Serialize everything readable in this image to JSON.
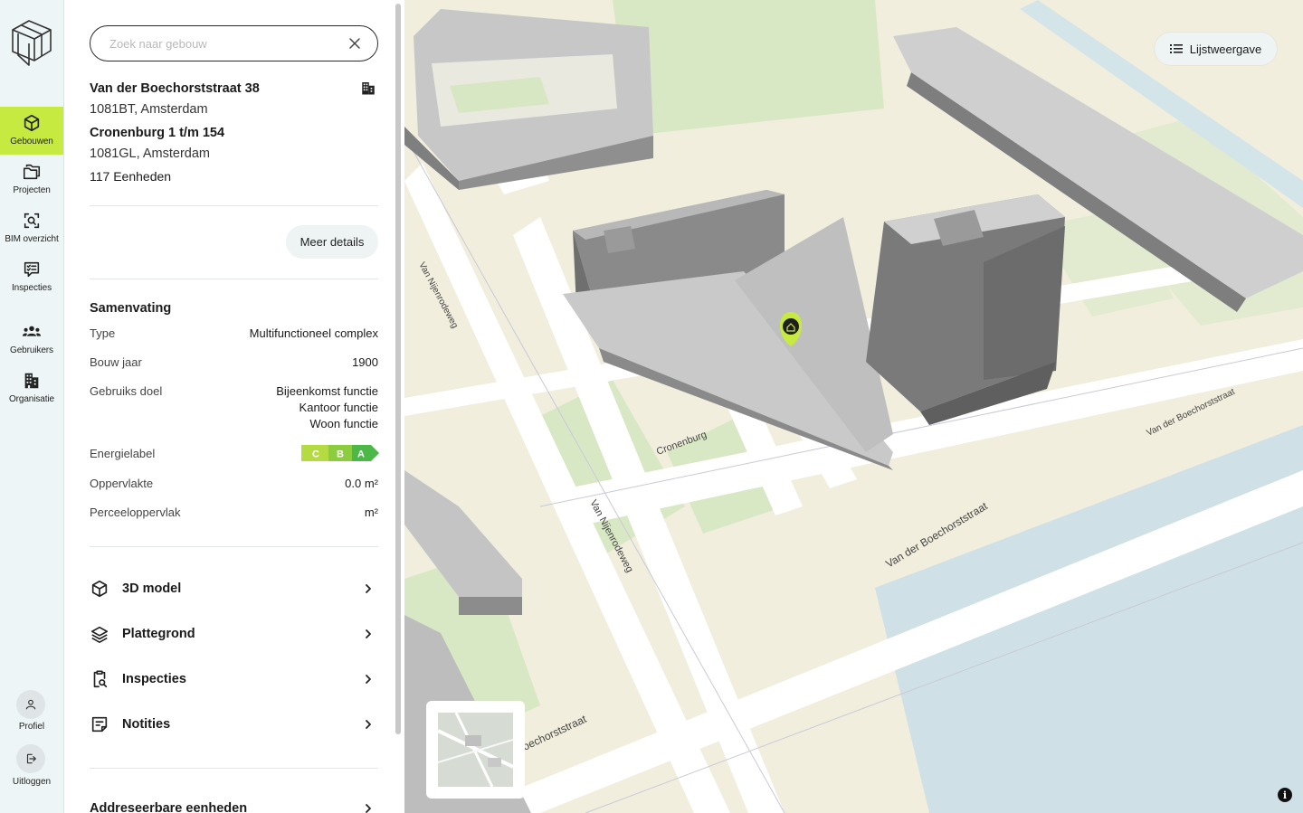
{
  "nav": {
    "items": [
      {
        "id": "gebouwen",
        "label": "Gebouwen",
        "icon": "cube-icon",
        "active": true
      },
      {
        "id": "projecten",
        "label": "Projecten",
        "icon": "folders-icon",
        "active": false
      },
      {
        "id": "bim",
        "label": "BIM overzicht",
        "icon": "scan-icon",
        "active": false
      },
      {
        "id": "inspecties",
        "label": "Inspecties",
        "icon": "checklist-icon",
        "active": false
      },
      {
        "id": "gebruikers",
        "label": "Gebruikers",
        "icon": "users-icon",
        "active": false
      },
      {
        "id": "organisatie",
        "label": "Organisatie",
        "icon": "building-icon",
        "active": false
      }
    ],
    "profile_label": "Profiel",
    "logout_label": "Uitloggen"
  },
  "search": {
    "placeholder": "Zoek naar gebouw",
    "value": ""
  },
  "building": {
    "address1_street": "Van der Boechorststraat 38",
    "address1_city": "1081BT, Amsterdam",
    "address2_street": "Cronenburg 1 t/m 154",
    "address2_city": "1081GL, Amsterdam",
    "units": "117 Eenheden",
    "details_button": "Meer details"
  },
  "summary": {
    "title": "Samenvating",
    "type_label": "Type",
    "type_value": "Multifunctioneel complex",
    "year_label": "Bouw jaar",
    "year_value": "1900",
    "use_label": "Gebruiks doel",
    "use_values": [
      "Bijeenkomst functie",
      "Kantoor functie",
      "Woon functie"
    ],
    "energy_label": "Energielabel",
    "energy_classes": [
      "C",
      "B",
      "A"
    ],
    "energy_colors": [
      "#b5db43",
      "#8ccc3f",
      "#4cb848"
    ],
    "area_label": "Oppervlakte",
    "area_value": "0.0 m²",
    "plot_label": "Perceeloppervlak",
    "plot_value": "m²"
  },
  "links": [
    {
      "label": "3D model",
      "icon": "cube-icon"
    },
    {
      "label": "Plattegrond",
      "icon": "layers-icon"
    },
    {
      "label": "Inspecties",
      "icon": "clipboard-search-icon"
    },
    {
      "label": "Notities",
      "icon": "note-icon"
    },
    {
      "label": "Addreseerbare eenheden",
      "icon": ""
    }
  ],
  "map": {
    "list_view_button": "Lijstweergave",
    "street_labels": [
      "Van Nijenrodeweg",
      "Van Nijenrodeweg",
      "Cronenburg",
      "Van der Boechorststraat",
      "Van der Boechorststraat",
      "oechorststraat"
    ],
    "info_button": "i",
    "accent": "#c7ea40"
  }
}
